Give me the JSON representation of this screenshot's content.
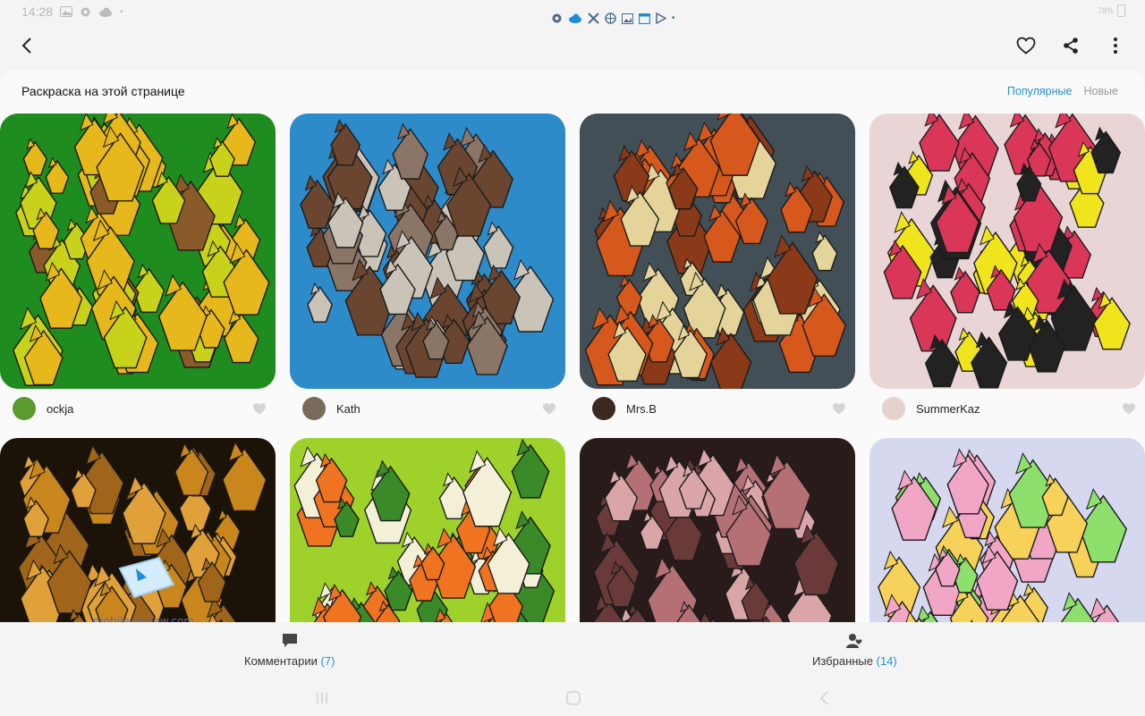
{
  "status": {
    "time": "14:28",
    "battery_text": "78%"
  },
  "appbar": {
    "icons": [
      "back-icon",
      "heart-icon",
      "share-icon",
      "more-vert-icon"
    ]
  },
  "section": {
    "title": "Раскраска на этой странице",
    "sort_tabs": [
      {
        "label": "Популярные",
        "active": true
      },
      {
        "label": "Новые",
        "active": false
      }
    ]
  },
  "tiles": [
    {
      "author": "ockja",
      "avatar_color": "#5a9a2e",
      "palette": [
        "#1f8c1f",
        "#c9d21a",
        "#e6b81c",
        "#8b5a2b"
      ]
    },
    {
      "author": "Kath",
      "avatar_color": "#7a6a5a",
      "palette": [
        "#2e8bc9",
        "#8a7566",
        "#c9c3b8",
        "#6a4630"
      ]
    },
    {
      "author": "Mrs.B",
      "avatar_color": "#3a2a20",
      "palette": [
        "#424f56",
        "#d6581c",
        "#e4d49a",
        "#8a3a18"
      ]
    },
    {
      "author": "SummerKaz",
      "avatar_color": "#e6d2cc",
      "palette": [
        "#e9d5d5",
        "#f0e41c",
        "#d93658",
        "#222222"
      ]
    },
    {
      "author": "",
      "avatar_color": "",
      "palette": [
        "#1b1208",
        "#c9861c",
        "#a0651a",
        "#e0a03a"
      ]
    },
    {
      "author": "",
      "avatar_color": "",
      "palette": [
        "#9ed12a",
        "#ef7320",
        "#f4f0d8",
        "#3a8a2a"
      ]
    },
    {
      "author": "",
      "avatar_color": "",
      "palette": [
        "#2a1b1b",
        "#b57076",
        "#d9a5a8",
        "#6a3a3a"
      ]
    },
    {
      "author": "",
      "avatar_color": "",
      "palette": [
        "#d5d8ee",
        "#f2a6c6",
        "#8ee06c",
        "#f6d25a"
      ]
    }
  ],
  "bottom": {
    "comments_label": "Комментарии",
    "comments_count": "(7)",
    "favorites_label": "Избранные",
    "favorites_count": "(14)"
  },
  "watermark": {
    "text": "mobile-review.com"
  }
}
